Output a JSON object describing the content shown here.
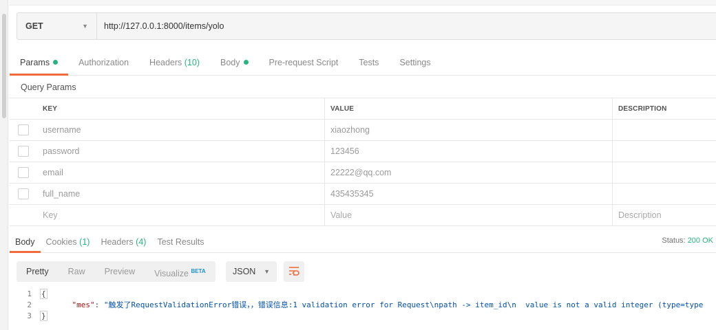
{
  "request": {
    "method": "GET",
    "url": "http://127.0.0.1:8000/items/yolo"
  },
  "request_tabs": [
    {
      "label": "Params",
      "active": true,
      "dot": true
    },
    {
      "label": "Authorization"
    },
    {
      "label": "Headers",
      "count": "(10)"
    },
    {
      "label": "Body",
      "dot": true
    },
    {
      "label": "Pre-request Script"
    },
    {
      "label": "Tests"
    },
    {
      "label": "Settings"
    }
  ],
  "query_params": {
    "title": "Query Params",
    "columns": {
      "key": "KEY",
      "value": "VALUE",
      "description": "DESCRIPTION"
    },
    "rows": [
      {
        "key": "username",
        "value": "xiaozhong",
        "description": ""
      },
      {
        "key": "password",
        "value": "123456",
        "description": ""
      },
      {
        "key": "email",
        "value": "22222@qq.com",
        "description": ""
      },
      {
        "key": "full_name",
        "value": "435435345",
        "description": ""
      }
    ],
    "placeholders": {
      "key": "Key",
      "value": "Value",
      "description": "Description"
    }
  },
  "response_tabs": [
    {
      "label": "Body",
      "active": true
    },
    {
      "label": "Cookies",
      "count": "(1)"
    },
    {
      "label": "Headers",
      "count": "(4)"
    },
    {
      "label": "Test Results"
    }
  ],
  "status": {
    "label": "Status:",
    "value": "200 OK"
  },
  "view_modes": [
    {
      "label": "Pretty",
      "active": true
    },
    {
      "label": "Raw"
    },
    {
      "label": "Preview"
    },
    {
      "label": "Visualize",
      "badge": "BETA"
    }
  ],
  "format": "JSON",
  "response_body": {
    "lines": [
      "1",
      "2",
      "3"
    ],
    "open": "{",
    "close": "}",
    "key": "\"mes\"",
    "separator": ": ",
    "value": "\"触发了RequestValidationError错误，，错误信息:1 validation error for Request\\npath -> item_id\\n  value is not a valid integer (type=type"
  },
  "colors": {
    "accent": "#f26b3a",
    "green": "#26b47f"
  }
}
